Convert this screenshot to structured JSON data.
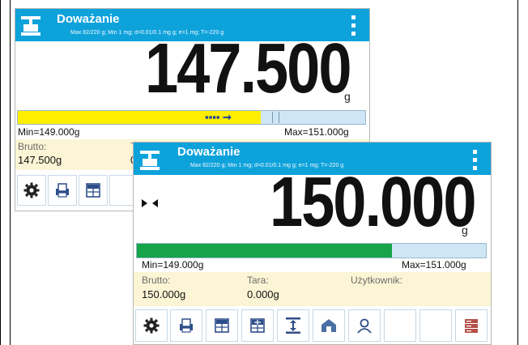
{
  "screen_back": {
    "title": "Doważanie",
    "subtitle": "Max 82/220 g; Min 1 mg; d=0.01/0.1 mg g; e=1 mg; T=-220 g",
    "value": "147.500",
    "unit": "g",
    "bar_fraction": 0.7,
    "bar_color": "#ffee00",
    "min_label": "Min=149.000g",
    "max_label": "Max=151.000g",
    "brutto_label": "Brutto:",
    "brutto_value": "147.500g",
    "tara_label_partial": "T",
    "tara_value_partial": "0"
  },
  "screen_front": {
    "title": "Doważanie",
    "subtitle": "Max 82/220 g; Min 1 mg; d=0.01/0.1 mg g; e=1 mg; T=-220 g",
    "value": "150.000",
    "unit": "g",
    "bar_fraction": 0.73,
    "bar_color": "#16a34a",
    "min_label": "Min=149.000g",
    "max_label": "Max=151.000g",
    "brutto_label": "Brutto:",
    "brutto_value": "150.000g",
    "tara_label": "Tara:",
    "tara_value": "0.000g",
    "user_label": "Użytkownik:",
    "user_value": ""
  },
  "toolbar_icons_front": [
    "settings-icon",
    "print-icon",
    "calculator-icon",
    "calculator-alt-icon",
    "tare-icon",
    "home-icon",
    "user-icon",
    "empty",
    "empty",
    "database-icon"
  ],
  "colors": {
    "header": "#0ea2db",
    "info_panel": "#fcf5d5",
    "accent": "#16a34a",
    "yellow": "#ffee00"
  }
}
